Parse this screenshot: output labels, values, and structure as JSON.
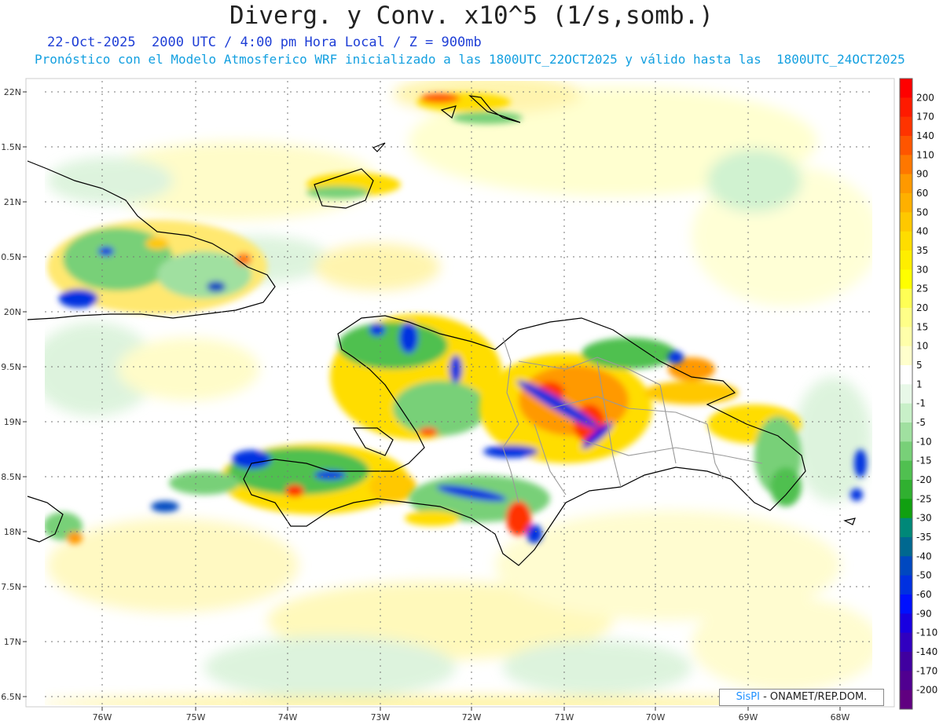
{
  "header": {
    "title": "Diverg. y Conv. x10^5 (1/s,somb.)",
    "subtitle1": "22-Oct-2025  2000 UTC / 4:00 pm Hora Local / Z = 900mb",
    "subtitle2": "Pronóstico con el Modelo Atmosferico WRF inicializado a las 1800UTC_22OCT2025 y válido hasta las  1800UTC_24OCT2025"
  },
  "map": {
    "lat_labels": [
      "22N",
      "1.5N",
      "21N",
      "0.5N",
      "20N",
      "9.5N",
      "19N",
      "8.5N",
      "18N",
      "7.5N",
      "17N",
      "6.5N"
    ],
    "lon_labels": [
      "76W",
      "75W",
      "74W",
      "73W",
      "72W",
      "71W",
      "70W",
      "69W",
      "68W"
    ]
  },
  "colorbar": {
    "levels": [
      {
        "label": "200",
        "color": "#ff0000"
      },
      {
        "label": "170",
        "color": "#ff1a00"
      },
      {
        "label": "140",
        "color": "#ff3300"
      },
      {
        "label": "110",
        "color": "#ff5500"
      },
      {
        "label": "90",
        "color": "#ff7700"
      },
      {
        "label": "60",
        "color": "#ff9900"
      },
      {
        "label": "50",
        "color": "#ffb000"
      },
      {
        "label": "40",
        "color": "#ffc800"
      },
      {
        "label": "35",
        "color": "#ffdd00"
      },
      {
        "label": "30",
        "color": "#ffee00"
      },
      {
        "label": "25",
        "color": "#ffff00"
      },
      {
        "label": "20",
        "color": "#ffff55"
      },
      {
        "label": "15",
        "color": "#ffff88"
      },
      {
        "label": "10",
        "color": "#ffffaa"
      },
      {
        "label": "5",
        "color": "#ffffcc"
      },
      {
        "label": "1",
        "color": "#ffffff"
      },
      {
        "label": "-1",
        "color": "#e8f8e8"
      },
      {
        "label": "-5",
        "color": "#c8f0c8"
      },
      {
        "label": "-10",
        "color": "#a0e0a0"
      },
      {
        "label": "-15",
        "color": "#78d078"
      },
      {
        "label": "-20",
        "color": "#50c050"
      },
      {
        "label": "-25",
        "color": "#30b030"
      },
      {
        "label": "-30",
        "color": "#10a010"
      },
      {
        "label": "-35",
        "color": "#008878"
      },
      {
        "label": "-40",
        "color": "#006890"
      },
      {
        "label": "-50",
        "color": "#0048c0"
      },
      {
        "label": "-60",
        "color": "#0030e0"
      },
      {
        "label": "-90",
        "color": "#0010ff"
      },
      {
        "label": "-110",
        "color": "#1800e0"
      },
      {
        "label": "-140",
        "color": "#3000c0"
      },
      {
        "label": "-170",
        "color": "#4000a0"
      },
      {
        "label": "-200",
        "color": "#500090"
      },
      {
        "label": "",
        "color": "#600080"
      }
    ]
  },
  "credit": {
    "brand": "SisPI",
    "text": "- ONAMET/REP.DOM."
  }
}
